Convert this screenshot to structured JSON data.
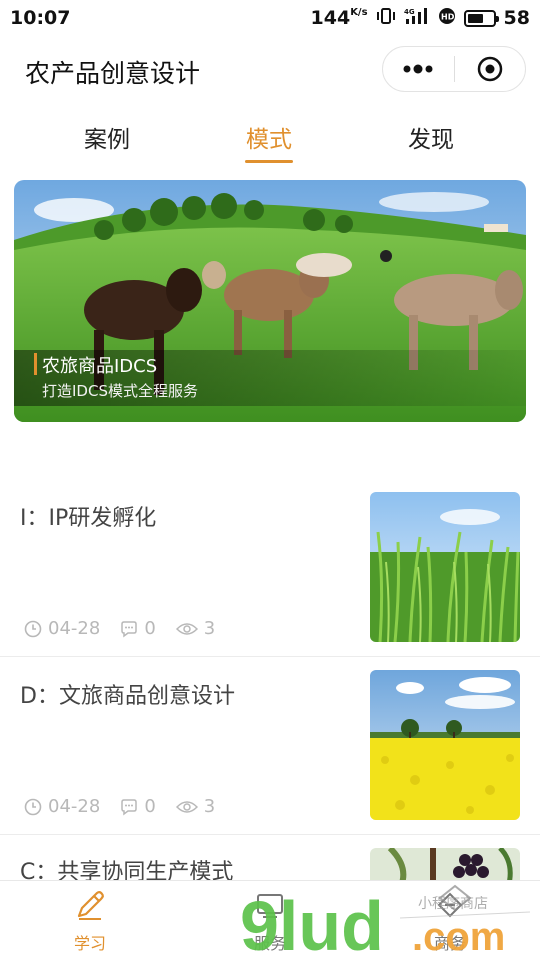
{
  "status_bar": {
    "time": "10:07",
    "speed_value": "144",
    "speed_unit": "K/s",
    "battery": "58"
  },
  "header": {
    "title": "农产品创意设计"
  },
  "tabs": [
    {
      "label": "案例",
      "active": false
    },
    {
      "label": "模式",
      "active": true
    },
    {
      "label": "发现",
      "active": false
    }
  ],
  "banner": {
    "title": "农旅商品IDCS",
    "subtitle": "打造IDCS模式全程服务"
  },
  "articles": [
    {
      "title": "I：IP研发孵化",
      "date": "04-28",
      "comments": "0",
      "views": "3",
      "thumb": "wheat-field"
    },
    {
      "title": "D：文旅商品创意设计",
      "date": "04-28",
      "comments": "0",
      "views": "3",
      "thumb": "rapeseed-field"
    },
    {
      "title": "C：共享协同生产模式",
      "thumb": "grapes"
    }
  ],
  "bottom_nav": [
    {
      "label": "学习",
      "icon": "pen-icon",
      "active": true
    },
    {
      "label": "服务",
      "icon": "service-icon",
      "active": false
    },
    {
      "label": "商务",
      "icon": "business-icon",
      "active": false
    }
  ],
  "watermark": {
    "text": "9lud.com",
    "tagline": "小程序商店"
  },
  "colors": {
    "accent": "#e0902e",
    "meta": "#b8b8b8",
    "watermark_green": "#5cc24a",
    "watermark_orange": "#f0a43a"
  }
}
